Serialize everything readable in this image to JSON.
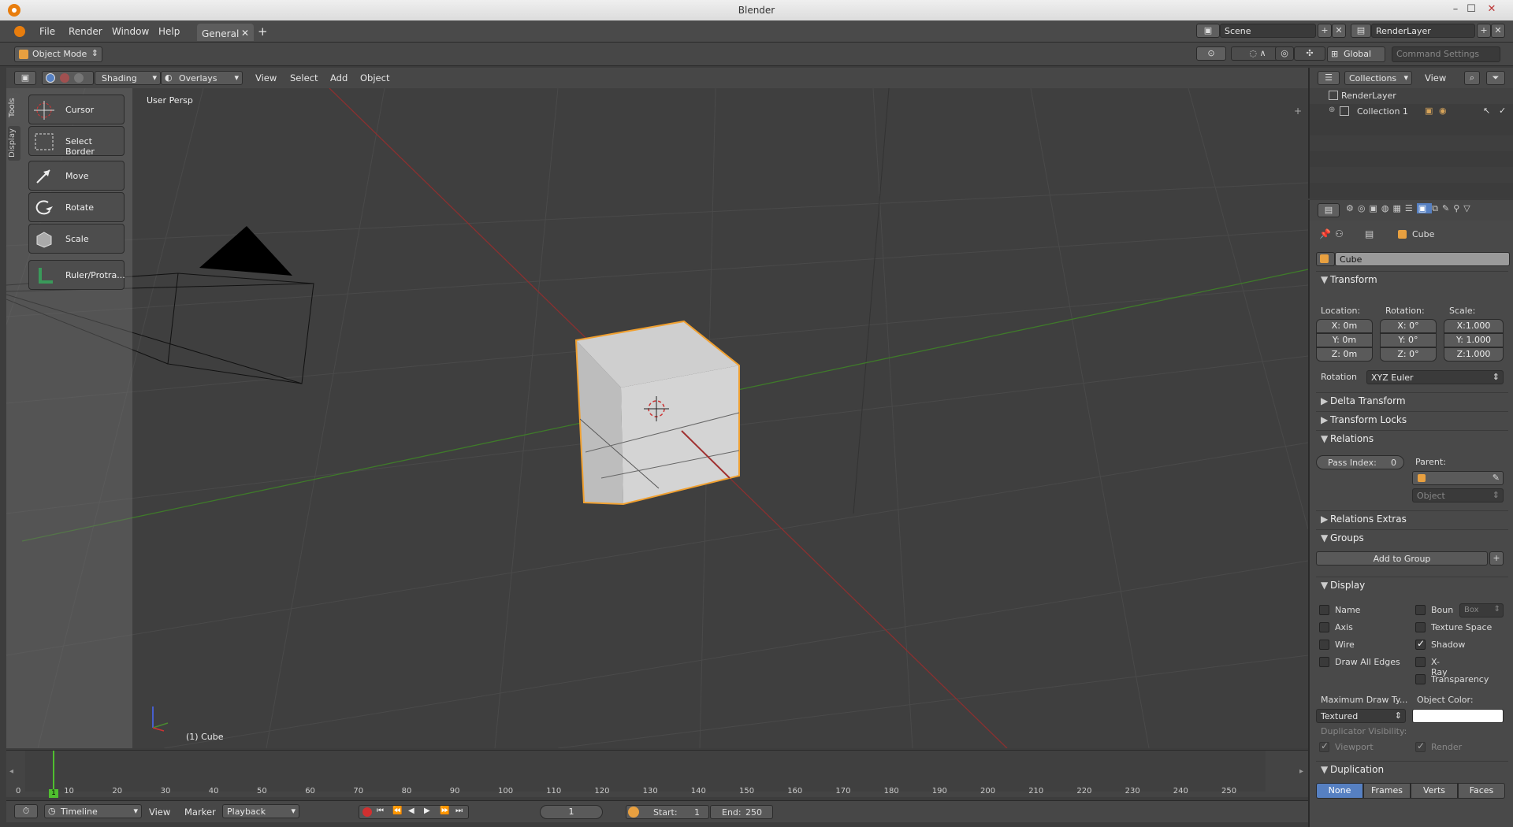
{
  "window": {
    "title": "Blender",
    "minimize": "–",
    "maximize": "☐",
    "close": "✕"
  },
  "menubar": {
    "items": [
      "File",
      "Render",
      "Window",
      "Help"
    ],
    "workspace_tab": "General",
    "add_tab": "+"
  },
  "scene": {
    "label": "Scene",
    "render_layer": "RenderLayer"
  },
  "toolbar": {
    "mode": "Object Mode",
    "orientation": "Global",
    "command_settings": "Command Settings"
  },
  "viewport_header": {
    "shading": "Shading",
    "overlays": "Overlays",
    "menus": [
      "View",
      "Select",
      "Add",
      "Object"
    ]
  },
  "viewport": {
    "view_name": "User Persp",
    "active_object": "(1) Cube"
  },
  "toolshelf": {
    "tabs": [
      "Tools",
      "Display"
    ],
    "tools": [
      "Cursor",
      "Select Border",
      "Move",
      "Rotate",
      "Scale",
      "Ruler/Protra..."
    ]
  },
  "timeline": {
    "ticks": [
      "0",
      "10",
      "20",
      "30",
      "40",
      "50",
      "60",
      "70",
      "80",
      "90",
      "100",
      "110",
      "120",
      "130",
      "140",
      "150",
      "160",
      "170",
      "180",
      "190",
      "200",
      "210",
      "220",
      "230",
      "240",
      "250"
    ],
    "current_frame_marker": "1",
    "editor": "Timeline",
    "menus": [
      "View",
      "Marker"
    ],
    "playback": "Playback",
    "frame": "1",
    "start_label": "Start:",
    "start": "1",
    "end_label": "End:",
    "end": "250"
  },
  "outliner": {
    "display_mode": "Collections",
    "view": "View",
    "items": [
      "RenderLayer",
      "Collection 1"
    ]
  },
  "properties": {
    "breadcrumb_object": "Cube",
    "object_name": "Cube",
    "transform": {
      "title": "Transform",
      "location_label": "Location:",
      "rotation_label": "Rotation:",
      "scale_label": "Scale:",
      "location": [
        "X:   0m",
        "Y:   0m",
        "Z:   0m"
      ],
      "rotation": [
        "X:   0°",
        "Y:   0°",
        "Z:   0°"
      ],
      "scale": [
        "X:1.000",
        "Y: 1.000",
        "Z:1.000"
      ],
      "rotation_mode_label": "Rotation",
      "rotation_mode": "XYZ Euler"
    },
    "delta_transform": "Delta Transform",
    "transform_locks": "Transform Locks",
    "relations": {
      "title": "Relations",
      "pass_index_label": "Pass Index:",
      "pass_index": "0",
      "parent_label": "Parent:",
      "parent_type": "Object"
    },
    "relations_extras": "Relations Extras",
    "groups": {
      "title": "Groups",
      "add_to_group": "Add to Group",
      "add": "+"
    },
    "display": {
      "title": "Display",
      "left": [
        {
          "label": "Name",
          "checked": false
        },
        {
          "label": "Axis",
          "checked": false
        },
        {
          "label": "Wire",
          "checked": false
        },
        {
          "label": "Draw All Edges",
          "checked": false
        }
      ],
      "right": [
        {
          "label": "Boun",
          "checked": false
        },
        {
          "label": "Texture Space",
          "checked": false
        },
        {
          "label": "Shadow",
          "checked": true
        },
        {
          "label": "X-Ray",
          "checked": false
        },
        {
          "label": "Transparency",
          "checked": false
        }
      ],
      "bounds_type": "Box",
      "max_draw_type_label": "Maximum Draw Ty...",
      "max_draw_type": "Textured",
      "object_color_label": "Object Color:",
      "object_color": "#ffffff",
      "duplicator_visibility_label": "Duplicator Visibility:",
      "dup_viewport": "Viewport",
      "dup_render": "Render"
    },
    "duplication": {
      "title": "Duplication",
      "options": [
        "None",
        "Frames",
        "Verts",
        "Faces"
      ],
      "selected": "None"
    }
  },
  "colors": {
    "selection_outline": "#f0a030",
    "x_axis": "#a03030",
    "y_axis": "#4a8a30",
    "accent_blue": "#5680c2"
  }
}
